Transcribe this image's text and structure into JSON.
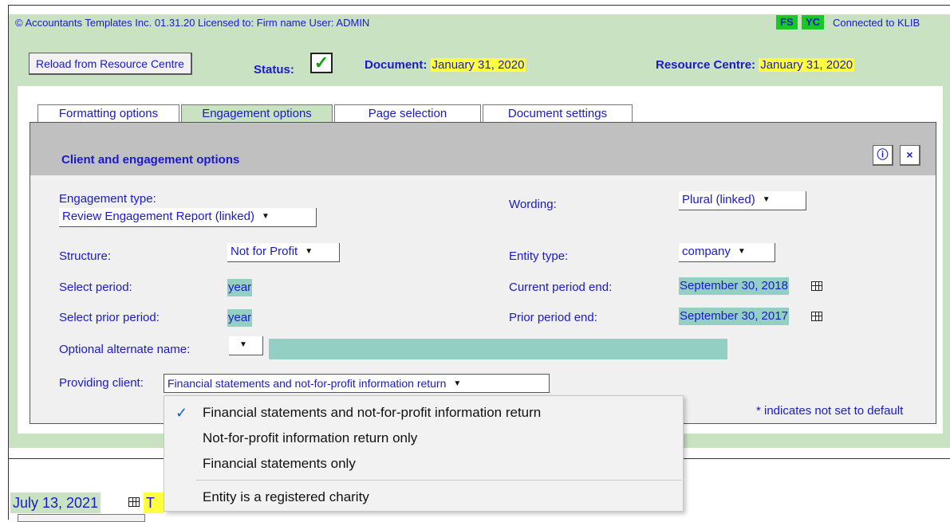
{
  "header": {
    "info_line": "© Accountants Templates Inc. 01.31.20 Licensed to: Firm name User: ADMIN",
    "tag_fs": "FS",
    "tag_yc": "YC",
    "connection": "Connected to KLIB",
    "reload_button": "Reload from Resource Centre",
    "status_label": "Status:",
    "status_check": "✓",
    "document_label": "Document:",
    "document_date": "January 31, 2020",
    "resource_centre_label": "Resource Centre:",
    "resource_centre_date": "January 31, 2020"
  },
  "tabs": [
    {
      "label": "Formatting options"
    },
    {
      "label": "Engagement options"
    },
    {
      "label": "Page selection"
    },
    {
      "label": "Document settings"
    }
  ],
  "panel": {
    "title": "Client and engagement options",
    "info_button": "ⓘ",
    "close_button": "×",
    "engagement_type_label": "Engagement type:",
    "engagement_type_value": "Review Engagement Report (linked)",
    "wording_label": "Wording:",
    "wording_value": "Plural (linked)",
    "structure_label": "Structure:",
    "structure_value": "Not for Profit",
    "entity_type_label": "Entity type:",
    "entity_type_value": "company",
    "select_period_label": "Select period:",
    "select_period_value": "year",
    "current_period_end_label": "Current period end:",
    "current_period_end_value": "September 30, 2018",
    "select_prior_period_label": "Select prior period:",
    "select_prior_period_value": "year",
    "prior_period_end_label": "Prior period end:",
    "prior_period_end_value": "September 30, 2017",
    "optional_alt_name_label": "Optional alternate name:",
    "providing_client_label": "Providing client:",
    "providing_client_value": "Financial statements and not-for-profit information return",
    "default_note": "* indicates not set to default"
  },
  "dropdown_menu": {
    "check": "✓",
    "items": [
      {
        "label": "Financial statements and not-for-profit information return",
        "selected": true
      },
      {
        "label": "Not-for-profit information return only",
        "selected": false
      },
      {
        "label": "Financial statements only",
        "selected": false
      },
      {
        "label": "Entity is a registered charity",
        "selected": false
      }
    ]
  },
  "bottom": {
    "date": "July 13, 2021",
    "highlight_text": "T"
  },
  "colors": {
    "text_blue": "#1a1ac8",
    "band_green": "#c8e2c2",
    "highlight_yellow": "#ffff40",
    "tag_green": "#19c828",
    "field_teal": "#94cfc4",
    "panel_header_gray": "#c0c0c0"
  }
}
